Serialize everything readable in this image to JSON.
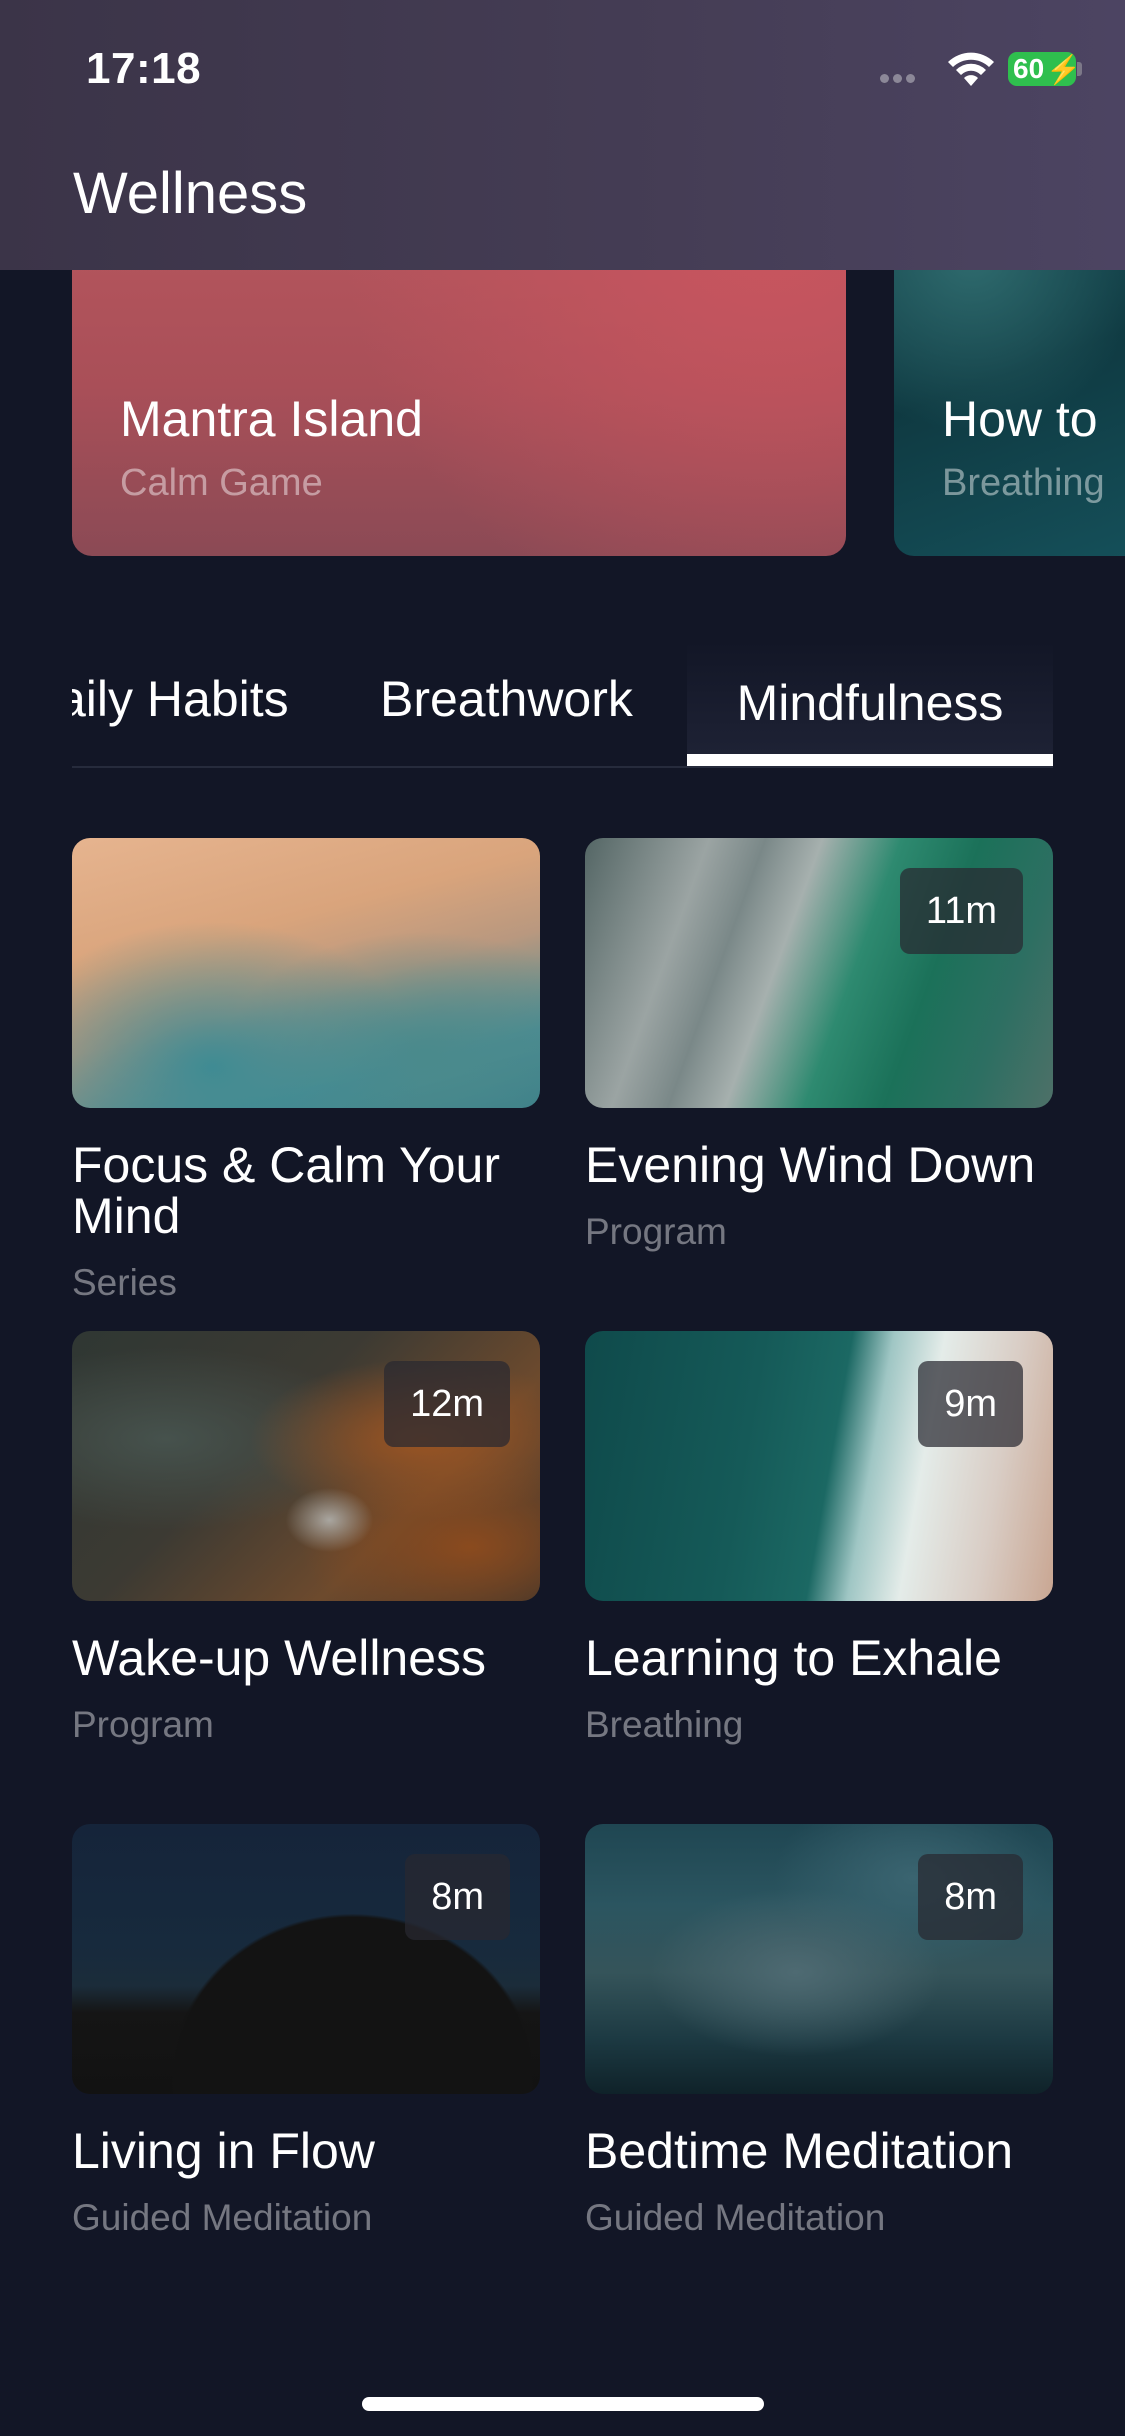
{
  "status_bar": {
    "time": "17:18",
    "battery": "60"
  },
  "header": {
    "title": "Wellness"
  },
  "featured": [
    {
      "title": "Mantra Island",
      "subtitle": "Calm Game"
    },
    {
      "title": "How to",
      "subtitle": "Breathing"
    }
  ],
  "tabs": [
    {
      "label": "aily Habits"
    },
    {
      "label": "Breathwork"
    },
    {
      "label": "Mindfulness",
      "selected": true
    }
  ],
  "cards": [
    {
      "title": "Focus & Calm Your Mind",
      "subtitle": "Series",
      "duration": ""
    },
    {
      "title": "Evening Wind Down",
      "subtitle": "Program",
      "duration": "11m"
    },
    {
      "title": "Wake-up Wellness",
      "subtitle": "Program",
      "duration": "12m"
    },
    {
      "title": "Learning to Exhale",
      "subtitle": "Breathing",
      "duration": "9m"
    },
    {
      "title": "Living in Flow",
      "subtitle": "Guided Meditation",
      "duration": "8m"
    },
    {
      "title": "Bedtime Meditation",
      "subtitle": "Guided Meditation",
      "duration": "8m"
    }
  ],
  "colors": {
    "background": "#121626",
    "header": "#453d55",
    "battery": "#2fbf4e"
  }
}
